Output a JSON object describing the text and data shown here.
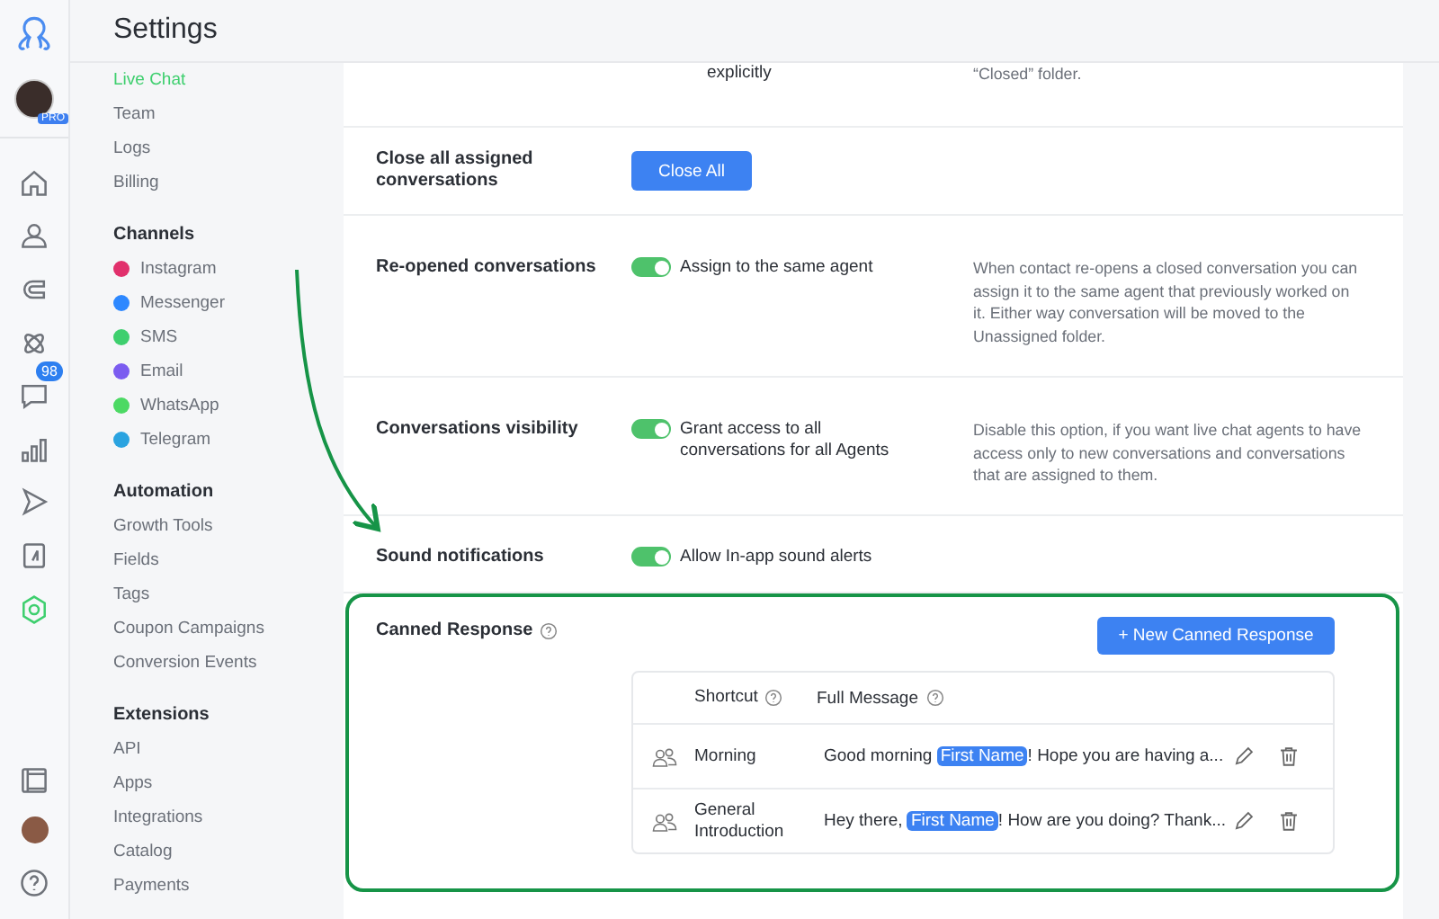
{
  "header": {
    "title": "Settings"
  },
  "rail": {
    "badge": "PRO",
    "items": [
      {
        "kind": "home",
        "selected": false
      },
      {
        "kind": "user",
        "selected": false
      },
      {
        "kind": "magnet",
        "selected": false
      },
      {
        "kind": "grid",
        "selected": false
      },
      {
        "kind": "chat",
        "selected": false,
        "badge": "98"
      },
      {
        "kind": "chart",
        "selected": false
      },
      {
        "kind": "send",
        "selected": false
      },
      {
        "kind": "book",
        "selected": false
      },
      {
        "kind": "gear",
        "selected": true
      }
    ],
    "bottom": [
      {
        "kind": "panel"
      },
      {
        "kind": "photo"
      },
      {
        "kind": "help"
      }
    ]
  },
  "sidebar": {
    "sections": [
      {
        "items": [
          {
            "label": "Live Chat",
            "selected": true
          },
          {
            "label": "Team",
            "selected": false
          },
          {
            "label": "Logs",
            "selected": false
          },
          {
            "label": "Billing",
            "selected": false
          }
        ]
      },
      {
        "title": "Channels",
        "items": [
          {
            "label": "Instagram",
            "selected": false,
            "color": "#e1306c"
          },
          {
            "label": "Messenger",
            "selected": false,
            "color": "#2d88ff"
          },
          {
            "label": "SMS",
            "selected": false,
            "color": "#3ecf6e"
          },
          {
            "label": "Email",
            "selected": false,
            "color": "#7b5cf0"
          },
          {
            "label": "WhatsApp",
            "selected": false,
            "color": "#4cd964"
          },
          {
            "label": "Telegram",
            "selected": false,
            "color": "#2aa3e0"
          }
        ]
      },
      {
        "title": "Automation",
        "items": [
          {
            "label": "Growth Tools",
            "selected": false
          },
          {
            "label": "Fields",
            "selected": false
          },
          {
            "label": "Tags",
            "selected": false
          },
          {
            "label": "Coupon Campaigns",
            "selected": false
          },
          {
            "label": "Conversion Events",
            "selected": false
          }
        ]
      },
      {
        "title": "Extensions",
        "items": [
          {
            "label": "API",
            "selected": false
          },
          {
            "label": "Apps",
            "selected": false
          },
          {
            "label": "Integrations",
            "selected": false
          },
          {
            "label": "Catalog",
            "selected": false
          },
          {
            "label": "Payments",
            "selected": false
          }
        ]
      }
    ]
  },
  "settings": [
    {
      "kind": "partial",
      "control_text": "explicitly",
      "description": "“Closed” folder."
    },
    {
      "kind": "button",
      "label": "Close all assigned conversations",
      "button": "Close All"
    },
    {
      "kind": "toggle",
      "label": "Re-opened conversations",
      "on": true,
      "toggle_label": "Assign to the same agent",
      "description": "When contact re-opens a closed conversation you can assign it to the same agent that previously worked on it. Either way conversation will be moved to the Unassigned folder."
    },
    {
      "kind": "toggle",
      "label": "Conversations visibility",
      "on": true,
      "toggle_label": "Grant access to all conversations for all Agents",
      "description": "Disable this option, if you want live chat agents to have access only to new conversations and conversations that are assigned to them."
    },
    {
      "kind": "toggle",
      "label": "Sound notifications",
      "on": true,
      "toggle_label": "Allow In-app sound alerts"
    }
  ],
  "canned": {
    "title": "Canned Response",
    "new_button": "+ New Canned Response",
    "columns": [
      "Shortcut",
      "Full Message"
    ],
    "rows": [
      {
        "shortcut": "Morning",
        "message_start": "Good morning ",
        "variable": "First Name",
        "message_end": "! Hope you are having a..."
      },
      {
        "shortcut": "General Introduction",
        "message_start": "Hey there, ",
        "variable": "First Name",
        "message_end": "! How are you doing? Thank..."
      }
    ]
  }
}
